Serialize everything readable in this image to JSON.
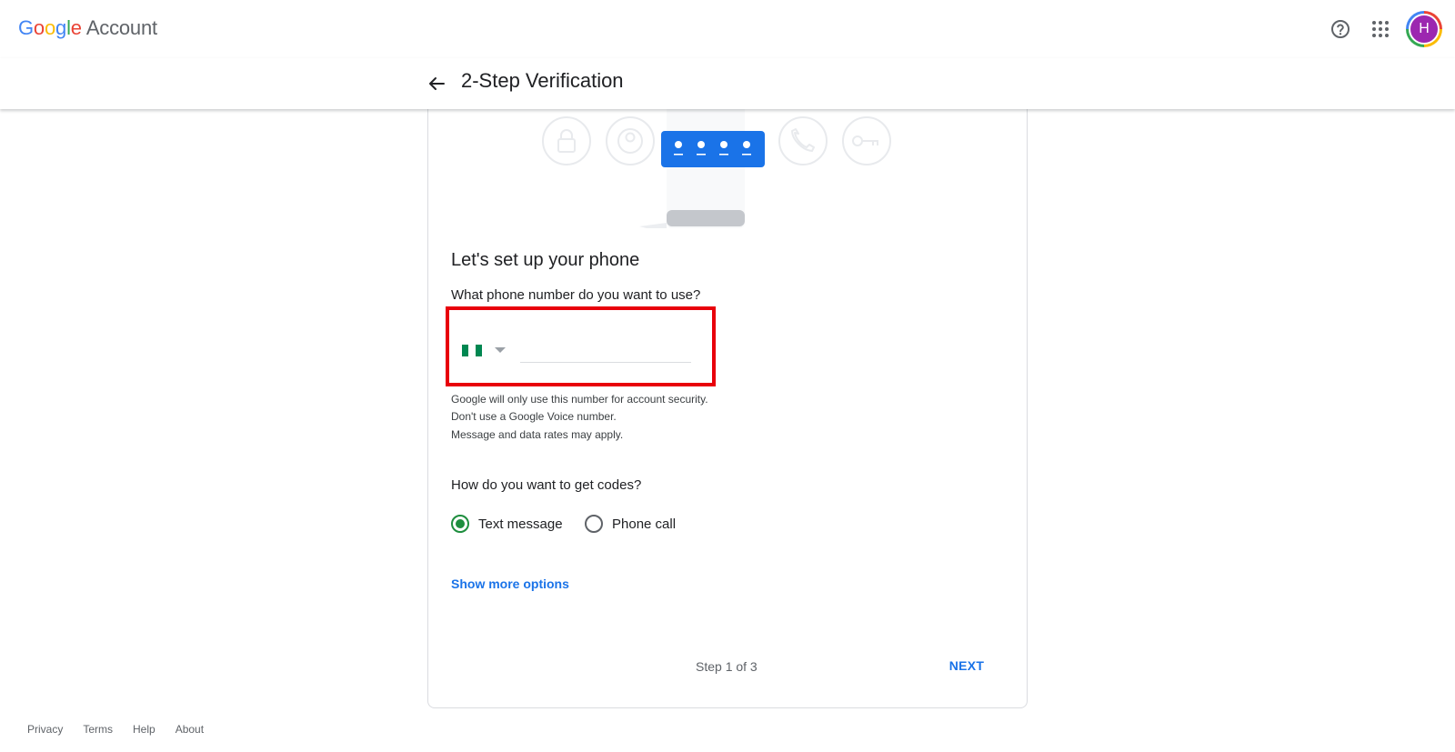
{
  "header": {
    "logo_letters": [
      "G",
      "o",
      "o",
      "g",
      "l",
      "e"
    ],
    "logo_product": "Account",
    "help_icon": "help-circle-icon",
    "apps_icon": "apps-grid-icon",
    "avatar_initial": "H",
    "avatar_color": "#9c27b0"
  },
  "subheader": {
    "back_icon": "arrow-left-icon",
    "title": "2-Step Verification"
  },
  "card": {
    "illustration": {
      "icons": [
        "lock-icon",
        "account-circle-icon",
        "code-dots-icon",
        "phone-icon",
        "key-icon"
      ],
      "accent_color": "#1a73e8"
    },
    "section_title": "Let's set up your phone",
    "phone_question": "What phone number do you want to use?",
    "phone_input": {
      "value": "",
      "placeholder": ""
    },
    "country": {
      "flag_colors": [
        "#008751",
        "#ffffff",
        "#008751"
      ]
    },
    "notes": [
      "Google will only use this number for account security.",
      "Don't use a Google Voice number.",
      "Message and data rates may apply."
    ],
    "codes_question": "How do you want to get codes?",
    "options": [
      {
        "label": "Text message",
        "selected": true
      },
      {
        "label": "Phone call",
        "selected": false
      }
    ],
    "more_options": "Show more options",
    "step": "Step 1 of 3",
    "next": "NEXT"
  },
  "footer": {
    "links": [
      "Privacy",
      "Terms",
      "Help",
      "About"
    ]
  },
  "colors": {
    "link_blue": "#1a73e8",
    "radio_green": "#1e8e3e",
    "highlight_red": "#e8000b"
  }
}
